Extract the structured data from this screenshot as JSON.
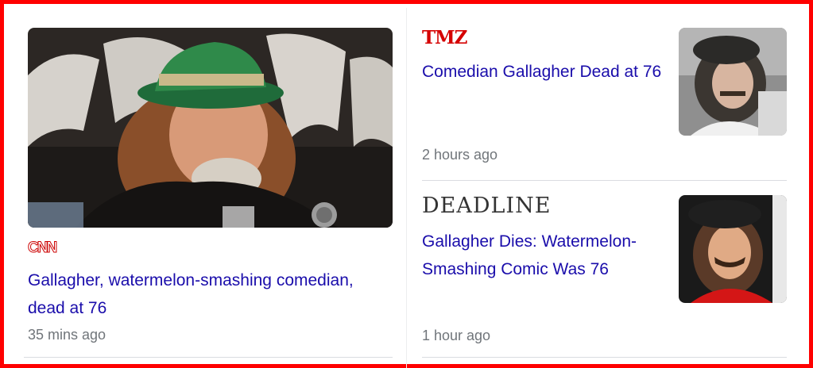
{
  "lead_story": {
    "source": "CNN",
    "headline": "Gallagher, watermelon-smashing comedian, dead at 76",
    "time": "35 mins ago"
  },
  "stories": [
    {
      "source": "TMZ",
      "headline": "Comedian Gallagher Dead at 76",
      "time": "2 hours ago"
    },
    {
      "source": "DEADLINE",
      "headline": "Gallagher Dies: Watermelon-Smashing Comic Was 76",
      "time": "1 hour ago"
    }
  ],
  "colors": {
    "frame": "#ff0000",
    "headline": "#1a0dab",
    "time": "#70757a"
  }
}
